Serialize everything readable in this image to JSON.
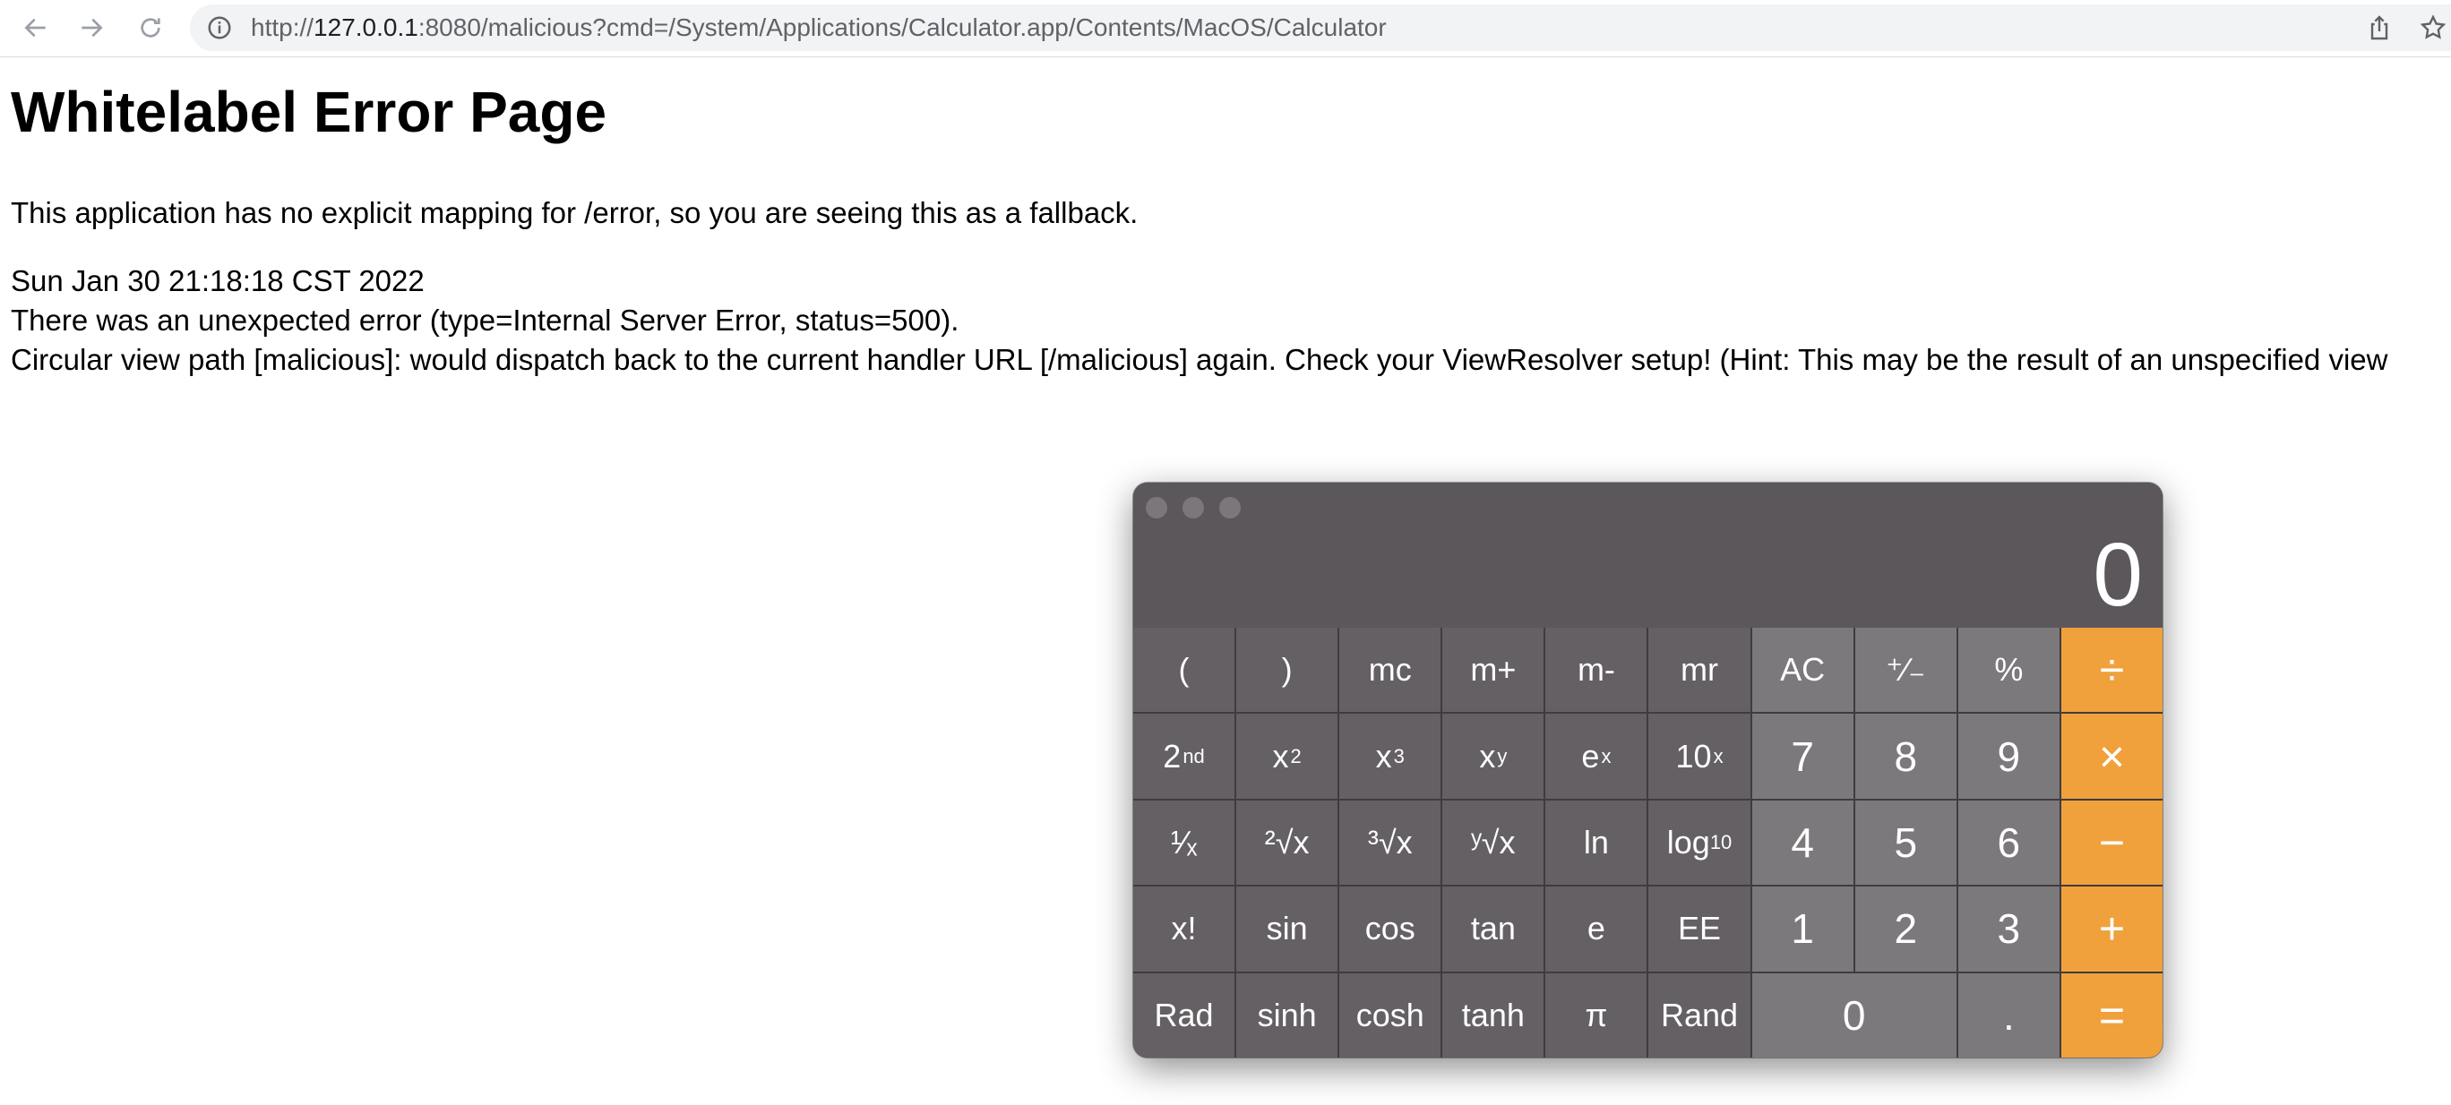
{
  "browser": {
    "url_prefix": "http://",
    "url_host": "127.0.0.1",
    "url_rest": ":8080/malicious?cmd=/System/Applications/Calculator.app/Contents/MacOS/Calculator"
  },
  "page": {
    "title": "Whitelabel Error Page",
    "fallback_message": "This application has no explicit mapping for /error, so you are seeing this as a fallback.",
    "timestamp": "Sun Jan 30 21:18:18 CST 2022",
    "error_line": "There was an unexpected error (type=Internal Server Error, status=500).",
    "detail_line": "Circular view path [malicious]: would dispatch back to the current handler URL [/malicious] again. Check your ViewResolver setup! (Hint: This may be the result of an unspecified view"
  },
  "calculator": {
    "display": "0",
    "row1": [
      "(",
      ")",
      "mc",
      "m+",
      "m-",
      "mr",
      "AC",
      "⁺∕₋",
      "%",
      "÷"
    ],
    "row2_plain": [
      "7",
      "8",
      "9",
      "×"
    ],
    "row3": [
      "¹∕ₓ",
      "²√x",
      "³√x",
      "ʸ√x",
      "ln",
      "4",
      "5",
      "6",
      "−"
    ],
    "row4": [
      "x!",
      "sin",
      "cos",
      "tan",
      "e",
      "EE",
      "1",
      "2",
      "3",
      "+"
    ],
    "row5": [
      "Rad",
      "sinh",
      "cosh",
      "tanh",
      "π",
      "Rand",
      "0",
      ".",
      "="
    ],
    "sci_labels": {
      "second_base": "2",
      "second_sup": "nd",
      "x2_base": "x",
      "x2_sup": "2",
      "x3_base": "x",
      "x3_sup": "3",
      "xy_base": "x",
      "xy_sup": "y",
      "ex_base": "e",
      "ex_sup": "x",
      "tenx_base": "10",
      "tenx_sup": "x",
      "log_base": "log",
      "log_sub": "10"
    },
    "colors": {
      "operator": "#f0a13c",
      "number_key": "#7c797c",
      "function_key": "#646064",
      "display_bg": "#5b575b"
    }
  }
}
